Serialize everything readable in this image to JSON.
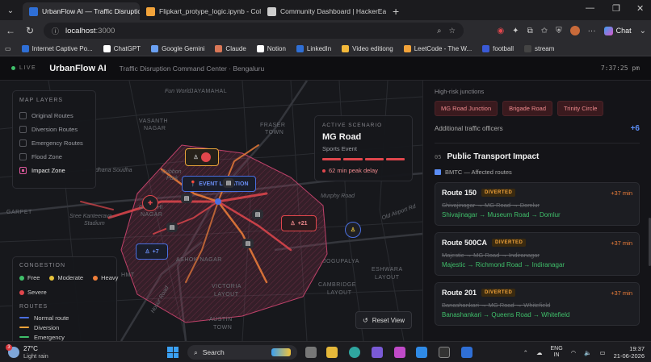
{
  "browser": {
    "tabs": [
      {
        "title": "UrbanFlow AI — Traffic Disruption",
        "active": true,
        "favicon_color": "#2f6fd6"
      },
      {
        "title": "Flipkart_protype_logic.ipynb - Cola",
        "active": false,
        "favicon_color": "#f2a33a"
      },
      {
        "title": "Community Dashboard | HackerEa",
        "active": false,
        "favicon_color": "#cccccc"
      }
    ],
    "url_host": "localhost",
    "url_port": ":3000",
    "chat_label": "Chat",
    "bookmarks": [
      {
        "label": "",
        "icon": "device-icon"
      },
      {
        "label": "Internet Captive Po...",
        "color": "#2f6fd6"
      },
      {
        "label": "ChatGPT",
        "color": "#ffffff"
      },
      {
        "label": "Google Gemini",
        "color": "#6aa0f2"
      },
      {
        "label": "Claude",
        "color": "#d97757"
      },
      {
        "label": "Notion",
        "color": "#ffffff"
      },
      {
        "label": "LinkedIn",
        "color": "#2f6fd6"
      },
      {
        "label": "Video editiong",
        "color": "#f2b83a"
      },
      {
        "label": "LeetCode - The W...",
        "color": "#f2a33a"
      },
      {
        "label": "football",
        "color": "#3a5ad6"
      },
      {
        "label": "stream",
        "color": "#222222"
      }
    ]
  },
  "app": {
    "live_label": "LIVE",
    "brand": "UrbanFlow AI",
    "subtitle": "Traffic Disruption Command Center · Bengaluru",
    "clock": "7:37:25 pm"
  },
  "map": {
    "labels": [
      "Fun World",
      "JAYAMAHAL",
      "VASANTH",
      "NAGAR",
      "FRASER",
      "TOWN",
      "Cubbon",
      "Park",
      "dhana Soudha",
      "GANDHI",
      "NAGAR",
      "Sree Kanteerava",
      "Stadium",
      "ASHOK NAGAR",
      "VICTORIA",
      "LAYOUT",
      "AUSTIN",
      "TOWN",
      "CAMBRIDGE",
      "LAYOUT",
      "ESHWARA",
      "LAYOUT",
      "Murphy Road",
      "JOGUPALYA",
      "GARPET",
      "HMT",
      "Hosur Road",
      "Old Airport Rd"
    ],
    "layers_title": "MAP LAYERS",
    "layers": [
      {
        "label": "Original Routes",
        "checked": false
      },
      {
        "label": "Diversion Routes",
        "checked": false
      },
      {
        "label": "Emergency Routes",
        "checked": false
      },
      {
        "label": "Flood Zone",
        "checked": false
      },
      {
        "label": "Impact Zone",
        "checked": true
      }
    ],
    "congestion_title": "CONGESTION",
    "congestion": [
      {
        "label": "Free",
        "color": "#3fbf6a"
      },
      {
        "label": "Moderate",
        "color": "#e6c23a"
      },
      {
        "label": "Heavy",
        "color": "#f07f3a"
      },
      {
        "label": "Severe",
        "color": "#e0464c"
      }
    ],
    "routes_title": "ROUTES",
    "routes": [
      {
        "label": "Normal route",
        "color": "#4a6fe0"
      },
      {
        "label": "Diversion",
        "color": "#f2a33a"
      },
      {
        "label": "Emergency",
        "color": "#3fbf6a"
      }
    ],
    "event_marker": "EVENT LOCATION",
    "markers": {
      "officers_plus_21": "+21",
      "officers_plus_7": "+7"
    },
    "reset_label": "Reset View"
  },
  "scenario": {
    "label": "ACTIVE SCENARIO",
    "name": "MG Road",
    "type": "Sports Event",
    "delay": "62 min peak delay"
  },
  "side": {
    "high_risk_label": "High-risk junctions",
    "junctions": [
      "MG Road Junction",
      "Brigade Road",
      "Trinity Circle"
    ],
    "officers_label": "Additional traffic officers",
    "officers_value": "+6",
    "section_num": "05",
    "section_title": "Public Transport Impact",
    "bmtc_label": "BMTC — Affected routes",
    "routes": [
      {
        "name": "Route 150",
        "badge": "DIVERTED",
        "delay": "+37 min",
        "old": "Shivajinagar → MG Road → Domlur",
        "new": "Shivajinagar → Museum Road → Domlur"
      },
      {
        "name": "Route 500CA",
        "badge": "DIVERTED",
        "delay": "+37 min",
        "old": "Majestic → MG Road → Indiranagar",
        "new": "Majestic → Richmond Road → Indiranagar"
      },
      {
        "name": "Route 201",
        "badge": "DIVERTED",
        "delay": "+37 min",
        "old": "Banashankari → MG Road → Whitefield",
        "new": "Banashankari → Queens Road → Whitefield"
      }
    ]
  },
  "taskbar": {
    "weather_temp": "27°C",
    "weather_cond": "Light rain",
    "notif_count": "3",
    "search_label": "Search",
    "lang_top": "ENG",
    "lang_bottom": "IN",
    "time": "19:37",
    "date": "21-06-2026"
  }
}
